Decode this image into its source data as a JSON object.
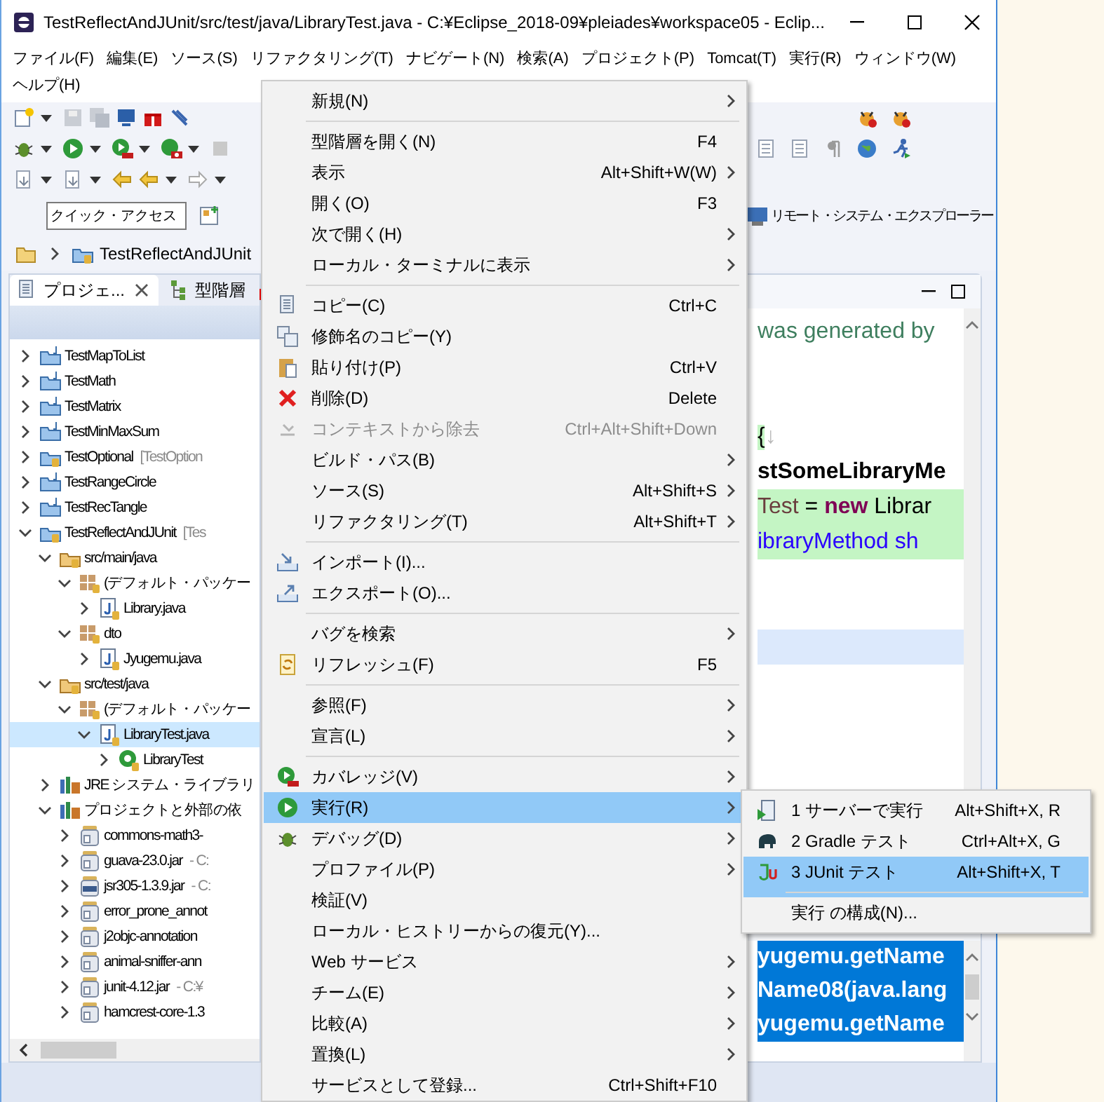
{
  "window": {
    "title": "TestReflectAndJUnit/src/test/java/LibraryTest.java - C:¥Eclipse_2018-09¥pleiades¥workspace05 - Eclip..."
  },
  "menu_bar": [
    "ファイル(F)",
    "編集(E)",
    "ソース(S)",
    "リファクタリング(T)",
    "ナビゲート(N)",
    "検索(A)",
    "プロジェクト(P)",
    "Tomcat(T)",
    "実行(R)",
    "ウィンドウ(W)",
    "ヘルプ(H)"
  ],
  "quick_access": {
    "placeholder": "クイック・アクセス"
  },
  "perspective_button": "リモート・システム・エクスプローラー",
  "breadcrumb": [
    "TestReflectAndJUnit"
  ],
  "explorer": {
    "tabs": [
      {
        "label": "プロジェ...",
        "selected": true
      },
      {
        "label": "型階層",
        "selected": false
      }
    ],
    "tree": [
      {
        "label": "TestMapToList",
        "kind": "project",
        "expanded": false,
        "selected": false
      },
      {
        "label": "TestMath",
        "kind": "project",
        "expanded": false,
        "selected": false
      },
      {
        "label": "TestMatrix",
        "kind": "project",
        "expanded": false,
        "selected": false
      },
      {
        "label": "TestMinMaxSum",
        "kind": "project",
        "expanded": false,
        "selected": false
      },
      {
        "label": "TestOptional",
        "decoration": "[TestOption",
        "kind": "project",
        "expanded": false,
        "selected": false
      },
      {
        "label": "TestRangeCircle",
        "kind": "project",
        "expanded": false,
        "selected": false
      },
      {
        "label": "TestRecTangle",
        "kind": "project",
        "expanded": false,
        "selected": false
      },
      {
        "label": "TestReflectAndJUnit",
        "decoration": "[Tes",
        "kind": "project",
        "expanded": true,
        "selected": false,
        "children": [
          {
            "label": "src/main/java",
            "kind": "source-folder",
            "expanded": true,
            "selected": false,
            "children": [
              {
                "label": "(デフォルト・パッケー",
                "kind": "package",
                "expanded": true,
                "selected": false,
                "children": [
                  {
                    "label": "Library.java",
                    "kind": "java-file",
                    "expanded": false,
                    "selected": false
                  }
                ]
              },
              {
                "label": "dto",
                "kind": "package",
                "expanded": true,
                "selected": false,
                "children": [
                  {
                    "label": "Jyugemu.java",
                    "kind": "java-file",
                    "expanded": false,
                    "selected": false
                  }
                ]
              }
            ]
          },
          {
            "label": "src/test/java",
            "kind": "source-folder",
            "expanded": true,
            "selected": false,
            "children": [
              {
                "label": "(デフォルト・パッケー",
                "kind": "package",
                "expanded": true,
                "selected": false,
                "children": [
                  {
                    "label": "LibraryTest.java",
                    "kind": "java-file",
                    "expanded": true,
                    "selected": true,
                    "children": [
                      {
                        "label": "LibraryTest",
                        "kind": "class",
                        "expanded": false,
                        "selected": false
                      }
                    ]
                  }
                ]
              }
            ]
          },
          {
            "label": "JRE システム・ライブラリ",
            "kind": "library",
            "expanded": false,
            "selected": false
          },
          {
            "label": "プロジェクトと外部の依",
            "kind": "library",
            "expanded": true,
            "selected": false,
            "children": [
              {
                "label": "commons-math3-",
                "kind": "jar",
                "expanded": false,
                "selected": false
              },
              {
                "label": "guava-23.0.jar",
                "decoration": "- C:",
                "kind": "jar",
                "expanded": false,
                "selected": false
              },
              {
                "label": "jsr305-1.3.9.jar",
                "decoration": "- C:",
                "kind": "binary-jar",
                "expanded": false,
                "selected": false
              },
              {
                "label": "error_prone_annot",
                "kind": "jar",
                "expanded": false,
                "selected": false
              },
              {
                "label": "j2objc-annotation",
                "kind": "jar",
                "expanded": false,
                "selected": false
              },
              {
                "label": "animal-sniffer-ann",
                "kind": "jar",
                "expanded": false,
                "selected": false
              },
              {
                "label": "junit-4.12.jar",
                "decoration": "- C:¥",
                "kind": "jar",
                "expanded": false,
                "selected": false
              },
              {
                "label": "hamcrest-core-1.3",
                "kind": "jar",
                "expanded": false,
                "selected": false
              }
            ]
          }
        ]
      }
    ]
  },
  "editor": {
    "code_lines": [
      {
        "marked": false,
        "current": false,
        "segments": [
          {
            "text": "was generated by",
            "kind": "comment",
            "marked": false
          }
        ]
      },
      {
        "marked": false,
        "current": false
      },
      {
        "marked": false,
        "current": false
      },
      {
        "marked": false,
        "current": false,
        "segments": [
          {
            "text": "{",
            "kind": "plain",
            "marked": true
          },
          {
            "text": "↓",
            "kind": "whitespace",
            "marked": false
          }
        ]
      },
      {
        "marked": false,
        "current": false,
        "segments": [
          {
            "text": "stSomeLibraryMe",
            "kind": "method",
            "marked": false
          }
        ]
      },
      {
        "marked": true,
        "current": false,
        "segments": [
          {
            "text": "Test",
            "kind": "variable"
          },
          {
            "text": " = ",
            "kind": "plain"
          },
          {
            "text": "new",
            "kind": "keyword"
          },
          {
            "text": " Librar",
            "kind": "plain"
          }
        ]
      },
      {
        "marked": true,
        "current": false,
        "segments": [
          {
            "text": "ibraryMethod sh",
            "kind": "string"
          }
        ]
      },
      {
        "marked": false,
        "current": false
      },
      {
        "marked": false,
        "current": false
      },
      {
        "marked": false,
        "current": true
      }
    ]
  },
  "console": {
    "lines": [
      {
        "text": "yugemu.getName",
        "selected": true
      },
      {
        "text": "Name08(java.lang",
        "selected": true
      },
      {
        "text": "yugemu.getName",
        "selected": true
      }
    ]
  },
  "context_menu": {
    "items": [
      {
        "label": "新規(N)",
        "has_submenu": true,
        "disabled": false,
        "selected": false,
        "separator_after": true
      },
      {
        "label": "型階層を開く(N)",
        "shortcut": "F4",
        "has_submenu": false,
        "disabled": false,
        "selected": false,
        "separator_after": false
      },
      {
        "label": "表示",
        "shortcut": "Alt+Shift+W(W)",
        "has_submenu": true,
        "disabled": false,
        "selected": false,
        "separator_after": false
      },
      {
        "label": "開く(O)",
        "shortcut": "F3",
        "has_submenu": false,
        "disabled": false,
        "selected": false,
        "separator_after": false
      },
      {
        "label": "次で開く(H)",
        "has_submenu": true,
        "disabled": false,
        "selected": false,
        "separator_after": false
      },
      {
        "label": "ローカル・ターミナルに表示",
        "has_submenu": true,
        "disabled": false,
        "selected": false,
        "separator_after": true
      },
      {
        "label": "コピー(C)",
        "shortcut": "Ctrl+C",
        "has_submenu": false,
        "disabled": false,
        "selected": false,
        "separator_after": false
      },
      {
        "label": "修飾名のコピー(Y)",
        "has_submenu": false,
        "disabled": false,
        "selected": false,
        "separator_after": false
      },
      {
        "label": "貼り付け(P)",
        "shortcut": "Ctrl+V",
        "has_submenu": false,
        "disabled": false,
        "selected": false,
        "separator_after": false
      },
      {
        "label": "削除(D)",
        "shortcut": "Delete",
        "has_submenu": false,
        "disabled": false,
        "selected": false,
        "separator_after": false
      },
      {
        "label": "コンテキストから除去",
        "shortcut": "Ctrl+Alt+Shift+Down",
        "has_submenu": false,
        "disabled": true,
        "selected": false,
        "separator_after": false
      },
      {
        "label": "ビルド・パス(B)",
        "has_submenu": true,
        "disabled": false,
        "selected": false,
        "separator_after": false
      },
      {
        "label": "ソース(S)",
        "shortcut": "Alt+Shift+S",
        "has_submenu": true,
        "disabled": false,
        "selected": false,
        "separator_after": false
      },
      {
        "label": "リファクタリング(T)",
        "shortcut": "Alt+Shift+T",
        "has_submenu": true,
        "disabled": false,
        "selected": false,
        "separator_after": true
      },
      {
        "label": "インポート(I)...",
        "has_submenu": false,
        "disabled": false,
        "selected": false,
        "separator_after": false
      },
      {
        "label": "エクスポート(O)...",
        "has_submenu": false,
        "disabled": false,
        "selected": false,
        "separator_after": true
      },
      {
        "label": "バグを検索",
        "has_submenu": true,
        "disabled": false,
        "selected": false,
        "separator_after": false
      },
      {
        "label": "リフレッシュ(F)",
        "shortcut": "F5",
        "has_submenu": false,
        "disabled": false,
        "selected": false,
        "separator_after": true
      },
      {
        "label": "参照(F)",
        "has_submenu": true,
        "disabled": false,
        "selected": false,
        "separator_after": false
      },
      {
        "label": "宣言(L)",
        "has_submenu": true,
        "disabled": false,
        "selected": false,
        "separator_after": true
      },
      {
        "label": "カバレッジ(V)",
        "has_submenu": true,
        "disabled": false,
        "selected": false,
        "separator_after": false
      },
      {
        "label": "実行(R)",
        "has_submenu": true,
        "disabled": false,
        "selected": true,
        "separator_after": false
      },
      {
        "label": "デバッグ(D)",
        "has_submenu": true,
        "disabled": false,
        "selected": false,
        "separator_after": false
      },
      {
        "label": "プロファイル(P)",
        "has_submenu": true,
        "disabled": false,
        "selected": false,
        "separator_after": false
      },
      {
        "label": "検証(V)",
        "has_submenu": false,
        "disabled": false,
        "selected": false,
        "separator_after": false
      },
      {
        "label": "ローカル・ヒストリーからの復元(Y)...",
        "has_submenu": false,
        "disabled": false,
        "selected": false,
        "separator_after": false
      },
      {
        "label": "Web サービス",
        "has_submenu": true,
        "disabled": false,
        "selected": false,
        "separator_after": false
      },
      {
        "label": "チーム(E)",
        "has_submenu": true,
        "disabled": false,
        "selected": false,
        "separator_after": false
      },
      {
        "label": "比較(A)",
        "has_submenu": true,
        "disabled": false,
        "selected": false,
        "separator_after": false
      },
      {
        "label": "置換(L)",
        "has_submenu": true,
        "disabled": false,
        "selected": false,
        "separator_after": false
      },
      {
        "label": "サービスとして登録...",
        "shortcut": "Ctrl+Shift+F10",
        "has_submenu": false,
        "disabled": false,
        "selected": false,
        "separator_after": false
      }
    ]
  },
  "submenu": {
    "items": [
      {
        "label": "1 サーバーで実行",
        "shortcut": "Alt+Shift+X, R",
        "selected": false,
        "separator_after": false
      },
      {
        "label": "2 Gradle テスト",
        "shortcut": "Ctrl+Alt+X, G",
        "selected": false,
        "separator_after": false
      },
      {
        "label": "3 JUnit テスト",
        "shortcut": "Alt+Shift+X, T",
        "selected": true,
        "separator_after": true
      },
      {
        "label": "実行 の構成(N)...",
        "selected": false,
        "separator_after": false
      }
    ]
  }
}
